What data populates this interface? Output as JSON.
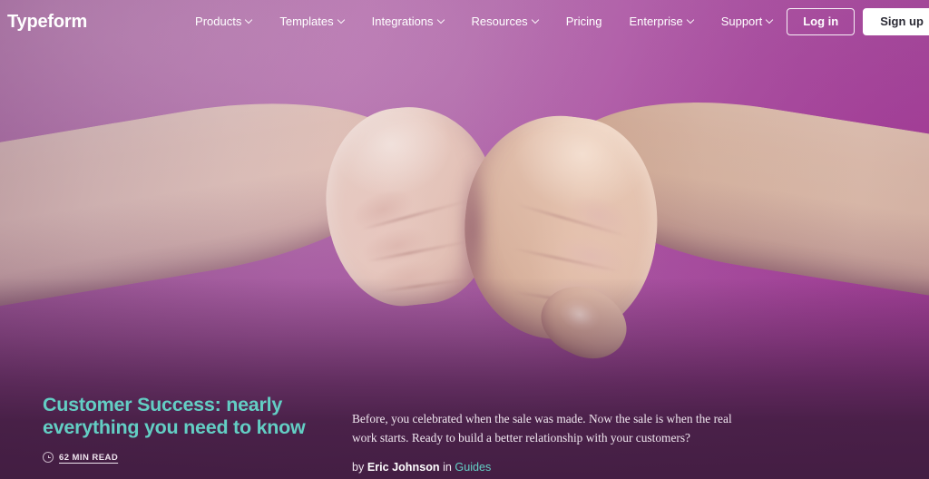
{
  "header": {
    "logo": "Typeform",
    "nav": [
      {
        "label": "Products",
        "has_caret": true,
        "icon": "chevron-down-icon"
      },
      {
        "label": "Templates",
        "has_caret": true,
        "icon": "chevron-down-icon"
      },
      {
        "label": "Integrations",
        "has_caret": true,
        "icon": "chevron-down-icon"
      },
      {
        "label": "Resources",
        "has_caret": true,
        "icon": "chevron-down-icon"
      },
      {
        "label": "Pricing",
        "has_caret": false,
        "icon": ""
      },
      {
        "label": "Enterprise",
        "has_caret": true,
        "icon": "chevron-down-icon"
      },
      {
        "label": "Support",
        "has_caret": true,
        "icon": "chevron-down-icon"
      }
    ],
    "login_label": "Log in",
    "signup_label": "Sign up"
  },
  "hero": {
    "image_description": "Two fists bumping against a magenta-purple background",
    "background_colors": {
      "top_left": "#c88cc0",
      "top_right": "#a7349 8",
      "right_mid": "#a1529c",
      "bottom": "#4a214a",
      "bottom_right": "#512451"
    }
  },
  "article": {
    "headline": "Customer Success: nearly everything you need to know",
    "read_time": "62 MIN READ",
    "read_time_icon": "clock-icon",
    "dek": "Before, you celebrated when the sale was made. Now the sale is when the real work starts. Ready to build a better relationship with your customers?",
    "byline_prefix": "by",
    "author": "Eric Johnson",
    "byline_join": "in",
    "category": "Guides"
  },
  "colors": {
    "accent_teal": "#63cec4",
    "text_light": "#f0e6ef",
    "white": "#ffffff",
    "signup_text": "#2b2b35"
  }
}
